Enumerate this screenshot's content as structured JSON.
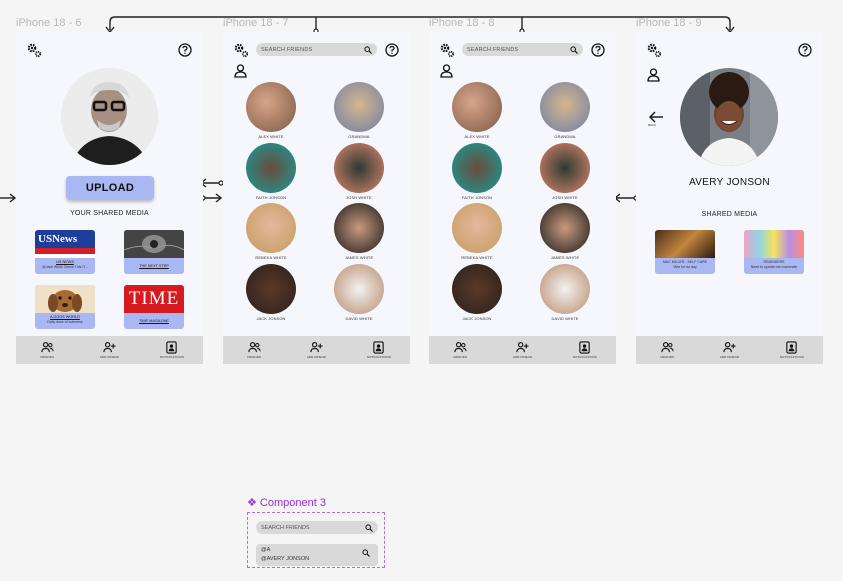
{
  "frames": [
    {
      "label": "iPhone 18 - 6"
    },
    {
      "label": "iPhone 18 - 7"
    },
    {
      "label": "iPhone 18 - 8"
    },
    {
      "label": "iPhone 18 - 9"
    }
  ],
  "search": {
    "placeholder": "SEARCH FRIENDS"
  },
  "nav": {
    "friends": "FRIENDS",
    "add_friend": "ADD FRIEND",
    "notifications": "NOTIFICATIONS"
  },
  "upload": {
    "label": "UPLOAD"
  },
  "your_shared_media": "YOUR SHARED MEDIA",
  "shared_media": "SHARED MEDIA",
  "media_cards": [
    {
      "title": "US NEWS",
      "caption": "@Jack White Check This O...",
      "thumb_text": "USNews"
    },
    {
      "title": "THE NEXT STEP",
      "caption": ""
    },
    {
      "title": "A DOGS WORLD",
      "caption": "Daily dose of cuteness"
    },
    {
      "title": "TIME MAGAZINE",
      "caption": "",
      "thumb_text": "TIME"
    }
  ],
  "friends": [
    {
      "name": "ALEX WHITE"
    },
    {
      "name": "GRANDMA"
    },
    {
      "name": "FAITH JONSON"
    },
    {
      "name": "JOSH WHITE"
    },
    {
      "name": "REBEKA WHITE"
    },
    {
      "name": "JAMES WHITE"
    },
    {
      "name": "JACK JONSON"
    },
    {
      "name": "DAVID WHITE"
    }
  ],
  "profile": {
    "name": "AVERY JONSON",
    "back_label": "BACK",
    "cards": [
      {
        "title": "MAC MILLER - SELF CARE",
        "caption": "Vibe for da day"
      },
      {
        "title": "REMINDERS",
        "caption": "Need to update me roommate"
      }
    ]
  },
  "component": {
    "label": "Component 3",
    "placeholder": "SEARCH FRIENDS",
    "typed": "@A",
    "result": "@AVERY JONSON"
  },
  "colors": {
    "accent": "#a9b7f2",
    "bar": "#d9d9d9",
    "frame": "#f6f7fc",
    "component": "#9b2fd0"
  }
}
